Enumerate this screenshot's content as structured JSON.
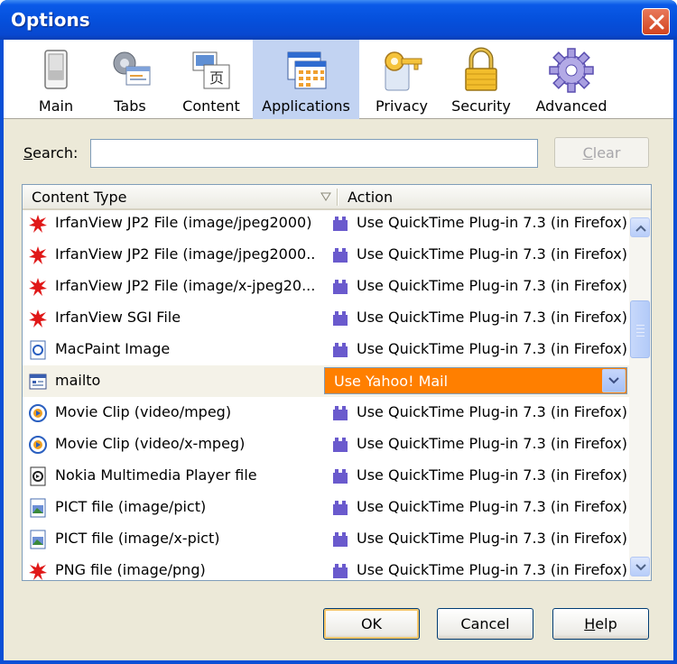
{
  "window": {
    "title": "Options"
  },
  "toolbar": {
    "items": [
      {
        "label": "Main",
        "icon": "main-switch-icon"
      },
      {
        "label": "Tabs",
        "icon": "tabs-icon"
      },
      {
        "label": "Content",
        "icon": "content-icon"
      },
      {
        "label": "Applications",
        "icon": "applications-icon",
        "selected": true
      },
      {
        "label": "Privacy",
        "icon": "privacy-key-icon"
      },
      {
        "label": "Security",
        "icon": "security-lock-icon"
      },
      {
        "label": "Advanced",
        "icon": "advanced-gear-icon"
      }
    ]
  },
  "search": {
    "label_prefix": "S",
    "label_rest": "earch:",
    "value": "",
    "clear_label_prefix": "C",
    "clear_label_rest": "lear"
  },
  "list": {
    "columns": {
      "content_type": "Content Type",
      "action": "Action"
    },
    "rows": [
      {
        "type": "IrfanView JP2 File (image/jpeg2000)",
        "icon": "irfanview-icon",
        "action": "Use QuickTime Plug-in 7.3 (in Firefox)"
      },
      {
        "type": "IrfanView JP2 File (image/jpeg2000...",
        "icon": "irfanview-icon",
        "action": "Use QuickTime Plug-in 7.3 (in Firefox)"
      },
      {
        "type": "IrfanView JP2 File (image/x-jpeg20...",
        "icon": "irfanview-icon",
        "action": "Use QuickTime Plug-in 7.3 (in Firefox)"
      },
      {
        "type": "IrfanView SGI File",
        "icon": "irfanview-icon",
        "action": "Use QuickTime Plug-in 7.3 (in Firefox)"
      },
      {
        "type": "MacPaint Image",
        "icon": "macpaint-icon",
        "action": "Use QuickTime Plug-in 7.3 (in Firefox)"
      },
      {
        "type": "mailto",
        "icon": "mailto-icon",
        "action": "Use Yahoo! Mail",
        "selected": true
      },
      {
        "type": "Movie Clip (video/mpeg)",
        "icon": "movie-clip-icon",
        "action": "Use QuickTime Plug-in 7.3 (in Firefox)"
      },
      {
        "type": "Movie Clip (video/x-mpeg)",
        "icon": "movie-clip-icon",
        "action": "Use QuickTime Plug-in 7.3 (in Firefox)"
      },
      {
        "type": "Nokia Multimedia Player file",
        "icon": "nokia-player-icon",
        "action": "Use QuickTime Plug-in 7.3 (in Firefox)"
      },
      {
        "type": "PICT file (image/pict)",
        "icon": "pict-file-icon",
        "action": "Use QuickTime Plug-in 7.3 (in Firefox)"
      },
      {
        "type": "PICT file (image/x-pict)",
        "icon": "pict-file-icon",
        "action": "Use QuickTime Plug-in 7.3 (in Firefox)"
      },
      {
        "type": "PNG file (image/png)",
        "icon": "irfanview-icon",
        "action": "Use QuickTime Plug-in 7.3 (in Firefox)"
      }
    ]
  },
  "buttons": {
    "ok": "OK",
    "cancel": "Cancel",
    "help_prefix": "H",
    "help_rest": "elp"
  },
  "colors": {
    "title_bar": "#0550dc",
    "selected_action_bg": "#ff7f00",
    "toolbar_selected": "#c2d3f2",
    "dialog_bg": "#ece9d8"
  }
}
